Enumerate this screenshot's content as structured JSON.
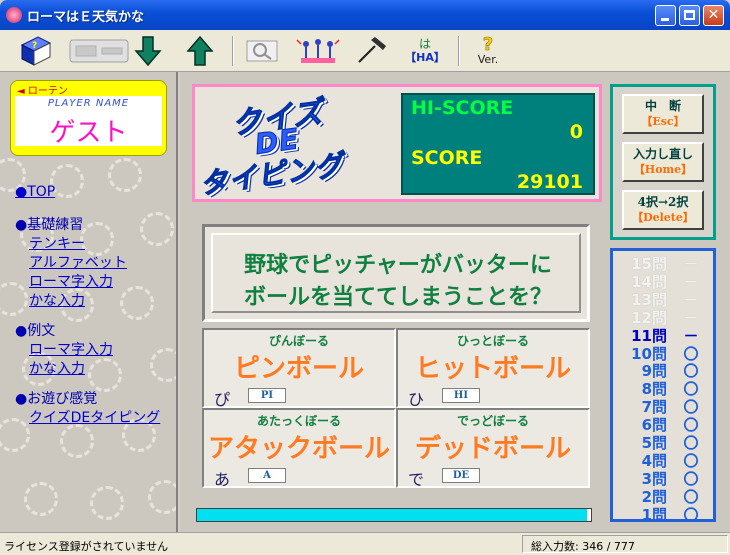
{
  "window": {
    "title": "ローマはＥ天気かな"
  },
  "toolbar": {
    "buttons": [
      {
        "name": "help-book",
        "icon": "book-icon"
      },
      {
        "name": "device",
        "icon": "device-icon"
      },
      {
        "name": "down",
        "icon": "arrow-down-icon"
      },
      {
        "name": "up",
        "icon": "arrow-up-icon"
      },
      {
        "name": "view",
        "icon": "magnifier-icon"
      },
      {
        "name": "players",
        "icon": "people-icon"
      },
      {
        "name": "hammer",
        "icon": "hammer-icon"
      },
      {
        "name": "ha",
        "label_top": "は",
        "label_bottom": "【HA】"
      },
      {
        "name": "version",
        "label_bottom": "Ver."
      }
    ]
  },
  "player": {
    "brand": "◄ ローテン",
    "label": "PLAYER  NAME",
    "name": "ゲスト"
  },
  "sidebar": {
    "top": "●TOP",
    "basic": "●基礎練習",
    "basic_items": [
      "テンキー",
      "アルファベット",
      "ローマ字入力",
      "かな入力"
    ],
    "sentences": "●例文",
    "sentence_items": [
      "ローマ字入力",
      "かな入力"
    ],
    "fun": "●お遊び感覚",
    "fun_items": [
      "クイズDEタイピング"
    ]
  },
  "logo": {
    "line1": "クイズ",
    "line2": "DE",
    "line3": "タイピング"
  },
  "score": {
    "hi_label": "HI-SCORE",
    "hi_value": "0",
    "score_label": "SCORE",
    "score_value": "29101"
  },
  "controls": [
    {
      "label": "中　断",
      "key": "【Esc】"
    },
    {
      "label": "入力し直し",
      "key": "【Home】"
    },
    {
      "label": "4択→2択",
      "key": "【Delete】"
    }
  ],
  "question": {
    "line1": "野球でピッチャーがバッターに",
    "line2": "ボールを当ててしまうことを？"
  },
  "choices": [
    {
      "reading": "ぴんぼーる",
      "word": "ピンボール",
      "kana": "ぴ",
      "key": "PI"
    },
    {
      "reading": "ひっとぼーる",
      "word": "ヒットボール",
      "kana": "ひ",
      "key": "HI"
    },
    {
      "reading": "あたっくぼーる",
      "word": "アタックボール",
      "kana": "あ",
      "key": "A"
    },
    {
      "reading": "でっどぼーる",
      "word": "デッドボール",
      "kana": "で",
      "key": "DE"
    }
  ],
  "progress": {
    "fraction": 0.99
  },
  "question_list": [
    {
      "num": "15問",
      "mark": "－",
      "state": "future"
    },
    {
      "num": "14問",
      "mark": "－",
      "state": "future"
    },
    {
      "num": "13問",
      "mark": "－",
      "state": "future"
    },
    {
      "num": "12問",
      "mark": "－",
      "state": "future"
    },
    {
      "num": "11問",
      "mark": "－",
      "state": "current"
    },
    {
      "num": "10問",
      "mark": "〇",
      "state": "done"
    },
    {
      "num": "9問",
      "mark": "〇",
      "state": "done"
    },
    {
      "num": "8問",
      "mark": "〇",
      "state": "done"
    },
    {
      "num": "7問",
      "mark": "〇",
      "state": "done"
    },
    {
      "num": "6問",
      "mark": "〇",
      "state": "done"
    },
    {
      "num": "5問",
      "mark": "〇",
      "state": "done"
    },
    {
      "num": "4問",
      "mark": "〇",
      "state": "done"
    },
    {
      "num": "3問",
      "mark": "〇",
      "state": "done"
    },
    {
      "num": "2問",
      "mark": "〇",
      "state": "done"
    },
    {
      "num": "1問",
      "mark": "〇",
      "state": "done"
    }
  ],
  "colors": {
    "future": "#f4f2ee",
    "current": "#0000c0",
    "done": "#2060d8"
  },
  "status": {
    "license": "ライセンス登録がされていません",
    "count": "総入力数:  346 / 777"
  }
}
